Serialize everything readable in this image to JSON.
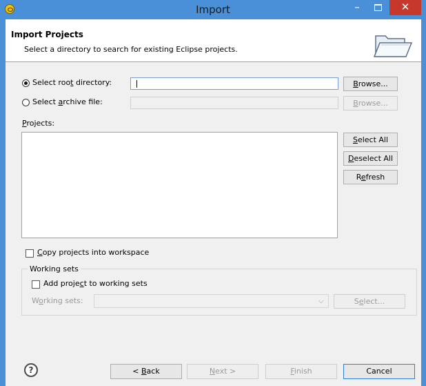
{
  "window": {
    "title": "Import",
    "min_symbol": "–",
    "close_symbol": "✕"
  },
  "header": {
    "title": "Import Projects",
    "description": "Select a directory to search for existing Eclipse projects."
  },
  "source": {
    "root_radio": {
      "prefix": "Select roo",
      "mnemonic": "t",
      "suffix": " directory:",
      "checked": true
    },
    "root_input_value": "",
    "root_browse": {
      "mnemonic": "B",
      "suffix": "rowse..."
    },
    "archive_radio": {
      "prefix": "Select ",
      "mnemonic": "a",
      "suffix": "rchive file:",
      "checked": false
    },
    "archive_input_value": "",
    "archive_browse": {
      "mnemonic": "B",
      "suffix": "rowse..."
    }
  },
  "projects": {
    "label_mnemonic": "P",
    "label_suffix": "rojects:",
    "items": [],
    "select_all": {
      "mnemonic": "S",
      "suffix": "elect All"
    },
    "deselect_all": {
      "mnemonic": "D",
      "suffix": "eselect All"
    },
    "refresh": {
      "prefix": "R",
      "mnemonic": "e",
      "suffix": "fresh"
    }
  },
  "options": {
    "copy_checkbox": {
      "mnemonic": "C",
      "suffix": "opy projects into workspace",
      "checked": false
    }
  },
  "working_sets": {
    "group_title": "Working sets",
    "add_checkbox": {
      "prefix": "Add proje",
      "mnemonic": "c",
      "suffix": "t to working sets",
      "checked": false
    },
    "label_prefix": "W",
    "label_mnemonic": "o",
    "label_suffix": "rking sets:",
    "combo_value": "",
    "select_button": {
      "prefix": "S",
      "mnemonic": "e",
      "suffix": "lect..."
    }
  },
  "footer": {
    "help": "?",
    "back": {
      "prefix": "< ",
      "mnemonic": "B",
      "suffix": "ack"
    },
    "next": {
      "mnemonic": "N",
      "suffix": "ext >"
    },
    "finish": {
      "mnemonic": "F",
      "suffix": "inish"
    },
    "cancel": "Cancel"
  },
  "colors": {
    "titlebar": "#4a90d9",
    "close_button": "#c7382c",
    "dialog_bg": "#f0f0f0"
  }
}
